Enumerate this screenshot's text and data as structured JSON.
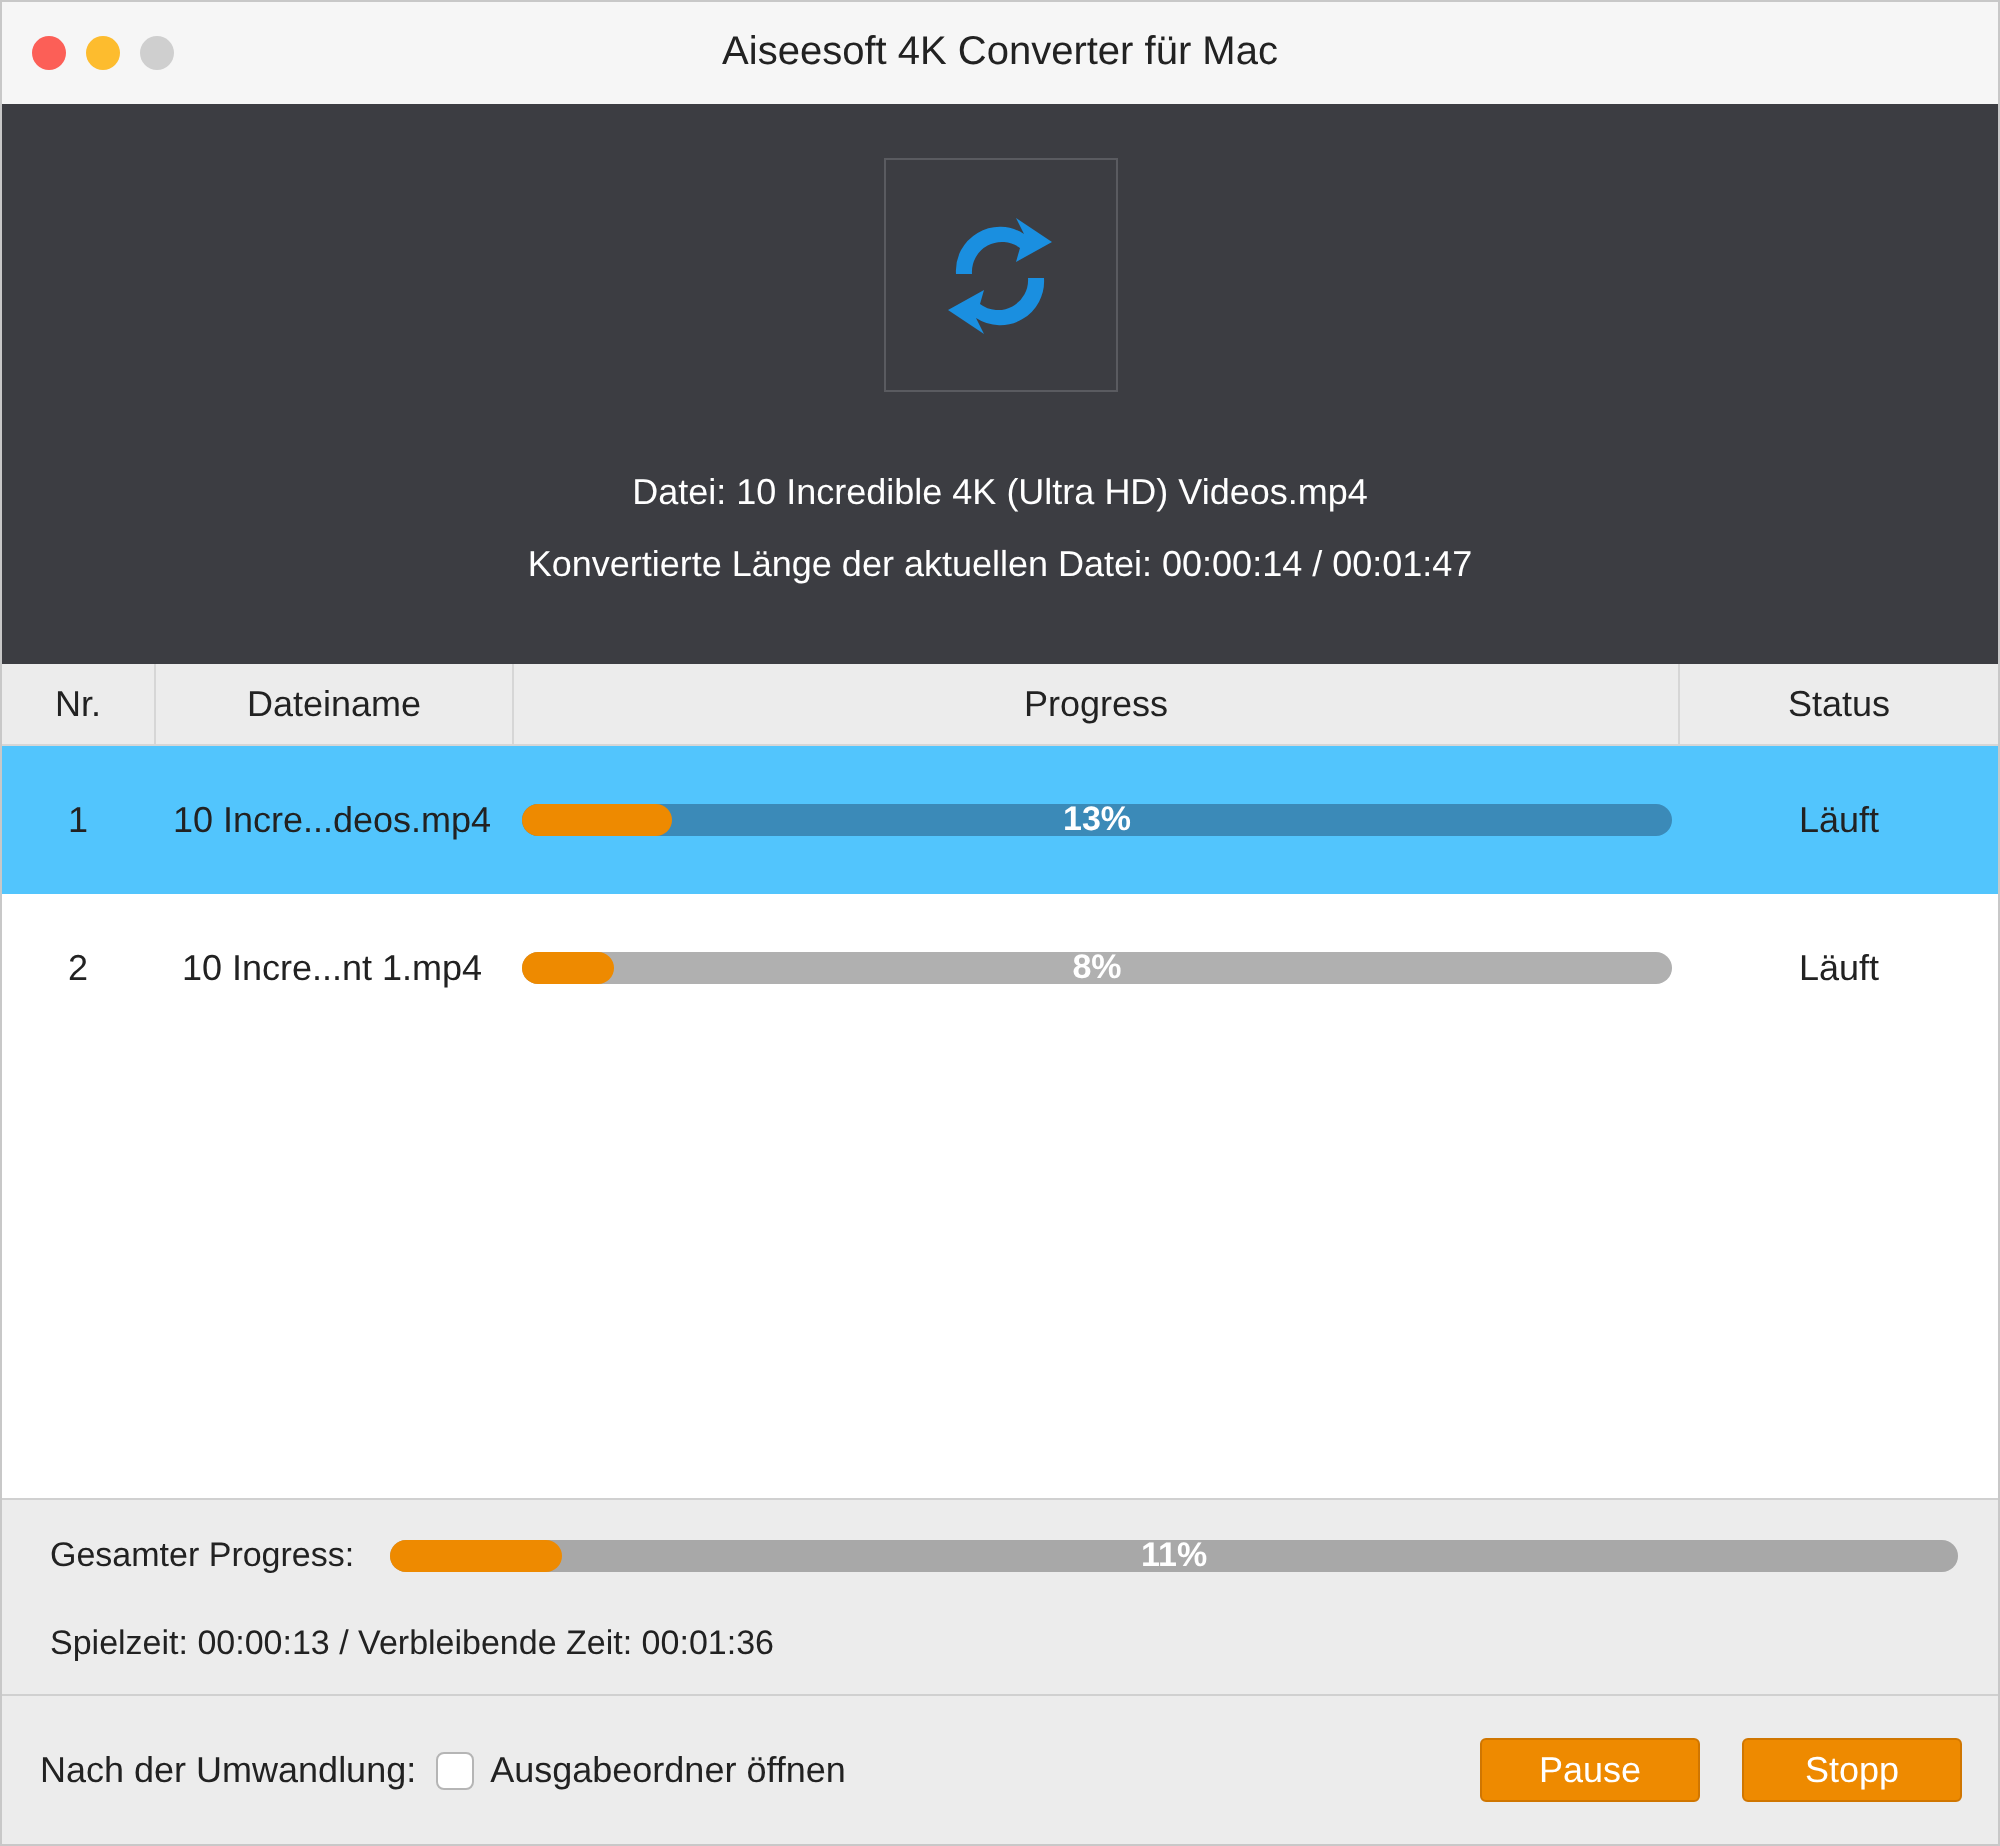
{
  "window": {
    "title": "Aiseesoft 4K Converter für Mac"
  },
  "header": {
    "file_line": "Datei: 10 Incredible 4K (Ultra HD) Videos.mp4",
    "length_line": "Konvertierte Länge der aktuellen Datei: 00:00:14 / 00:01:47"
  },
  "table": {
    "columns": [
      "Nr.",
      "Dateiname",
      "Progress",
      "Status"
    ],
    "rows": [
      {
        "nr": "1",
        "name": "10 Incre...deos.mp4",
        "level": 0.13,
        "percent": "13%",
        "status": "Läuft",
        "selected": true
      },
      {
        "nr": "2",
        "name": "10 Incre...nt 1.mp4",
        "level": 0.08,
        "percent": "8%",
        "status": "Läuft",
        "selected": false
      }
    ]
  },
  "overall": {
    "label": "Gesamter Progress:",
    "level": 0.11,
    "percent": "11%",
    "times": "Spielzeit: 00:00:13 / Verbleibende Zeit: 00:01:36"
  },
  "footer": {
    "label": "Nach der Umwandlung:",
    "checkbox": {
      "label": "Ausgabeordner öffnen",
      "checked": false
    },
    "buttons": [
      "Pause",
      "Stopp"
    ]
  }
}
